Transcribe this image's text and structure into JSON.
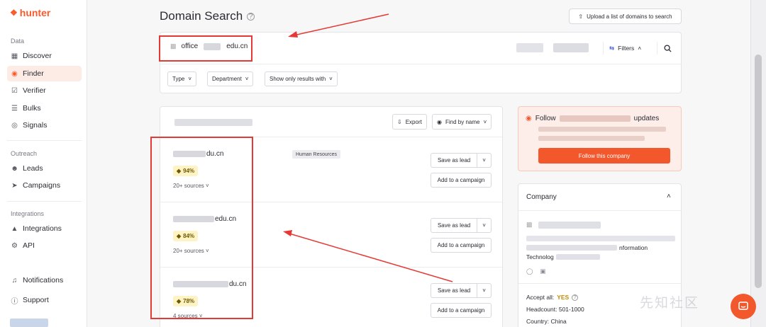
{
  "app": {
    "name": "hunter"
  },
  "sidebar": {
    "section_data": "Data",
    "data_items": [
      {
        "label": "Discover",
        "icon": "discover-icon"
      },
      {
        "label": "Finder",
        "icon": "finder-icon",
        "active": true
      },
      {
        "label": "Verifier",
        "icon": "verifier-icon"
      },
      {
        "label": "Bulks",
        "icon": "bulks-icon"
      },
      {
        "label": "Signals",
        "icon": "signals-icon"
      }
    ],
    "section_outreach": "Outreach",
    "outreach_items": [
      {
        "label": "Leads",
        "icon": "leads-icon"
      },
      {
        "label": "Campaigns",
        "icon": "campaigns-icon"
      }
    ],
    "section_integrations": "Integrations",
    "integration_items": [
      {
        "label": "Integrations",
        "icon": "integrations-icon"
      },
      {
        "label": "API",
        "icon": "api-icon"
      }
    ],
    "notifications": "Notifications",
    "support": "Support"
  },
  "header": {
    "title": "Domain Search",
    "upload_label": "Upload a list of domains to search"
  },
  "search": {
    "domain_prefix": "office",
    "domain_suffix": "edu.cn",
    "filters_label": "Filters",
    "filter_buttons": [
      "Type",
      "Department",
      "Show only results with"
    ]
  },
  "results": {
    "export_label": "Export",
    "find_by_name_label": "Find by name",
    "rows": [
      {
        "email_suffix": "du.cn",
        "department": "Human Resources",
        "confidence": "94%",
        "sources": "20+ sources"
      },
      {
        "email_suffix": "edu.cn",
        "department": "",
        "confidence": "84%",
        "sources": "20+ sources"
      },
      {
        "email_suffix": "du.cn",
        "department": "",
        "confidence": "78%",
        "sources": "4 sources"
      }
    ],
    "save_label": "Save as lead",
    "campaign_label": "Add to a campaign"
  },
  "follow": {
    "title_prefix": "Follow",
    "title_suffix": "updates",
    "button_label": "Follow this company"
  },
  "company": {
    "title": "Company",
    "industry_fragment": "nformation",
    "industry_line2": "Technolog",
    "accept_all_label": "Accept all:",
    "accept_all_value": "YES",
    "headcount": "Headcount: 501-1000",
    "country": "Country: China"
  },
  "watermark": "先知社区",
  "colors": {
    "brand": "#fa5b2d",
    "annotation": "#e53935"
  }
}
